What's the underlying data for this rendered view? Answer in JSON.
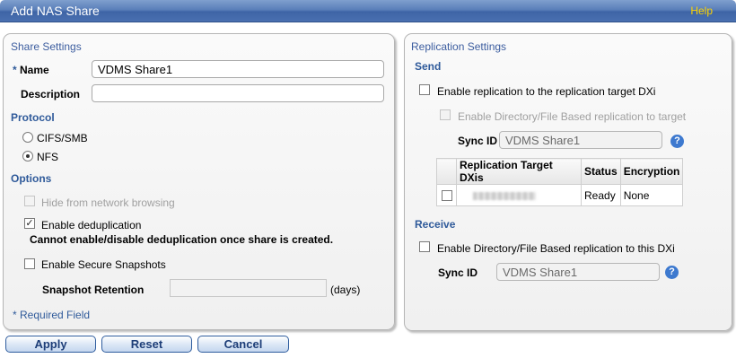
{
  "window": {
    "title": "Add NAS Share",
    "help_label": "Help"
  },
  "share_settings": {
    "section_title": "Share Settings",
    "required_marker": "*",
    "name_label": "Name",
    "name_value": "VDMS Share1",
    "description_label": "Description",
    "description_value": "",
    "protocol_title": "Protocol",
    "protocols": [
      {
        "label": "CIFS/SMB",
        "selected": false
      },
      {
        "label": "NFS",
        "selected": true
      }
    ],
    "options_title": "Options",
    "hide_label": "Hide from network browsing",
    "dedup_label": "Enable deduplication",
    "dedup_note": "Cannot enable/disable deduplication once share is created.",
    "snapshots_label": "Enable Secure Snapshots",
    "retention_label": "Snapshot Retention",
    "retention_value": "",
    "retention_unit": "(days)",
    "required_note": "* Required Field"
  },
  "replication_settings": {
    "section_title": "Replication Settings",
    "send_title": "Send",
    "enable_replication_label": "Enable replication to the replication target DXi",
    "enable_dir_target_label": "Enable Directory/File Based replication to target",
    "sync_id_label": "Sync ID",
    "sync_id_value": "VDMS Share1",
    "table": {
      "columns": [
        "Replication Target DXis",
        "Status",
        "Encryption"
      ],
      "rows": [
        {
          "status": "Ready",
          "encryption": "None"
        }
      ]
    },
    "receive_title": "Receive",
    "enable_dir_this_label": "Enable Directory/File Based replication to this DXi",
    "receive_sync_id_label": "Sync ID",
    "receive_sync_id_value": "VDMS Share1"
  },
  "buttons": {
    "apply": "Apply",
    "reset": "Reset",
    "cancel": "Cancel"
  },
  "icons": {
    "help": "question-icon",
    "check": "checkmark-icon"
  },
  "colors": {
    "titlebar": "#4a70b0",
    "help_link": "#ffd400",
    "section_title": "#3c5d9f",
    "help_icon": "#3d79cf"
  }
}
